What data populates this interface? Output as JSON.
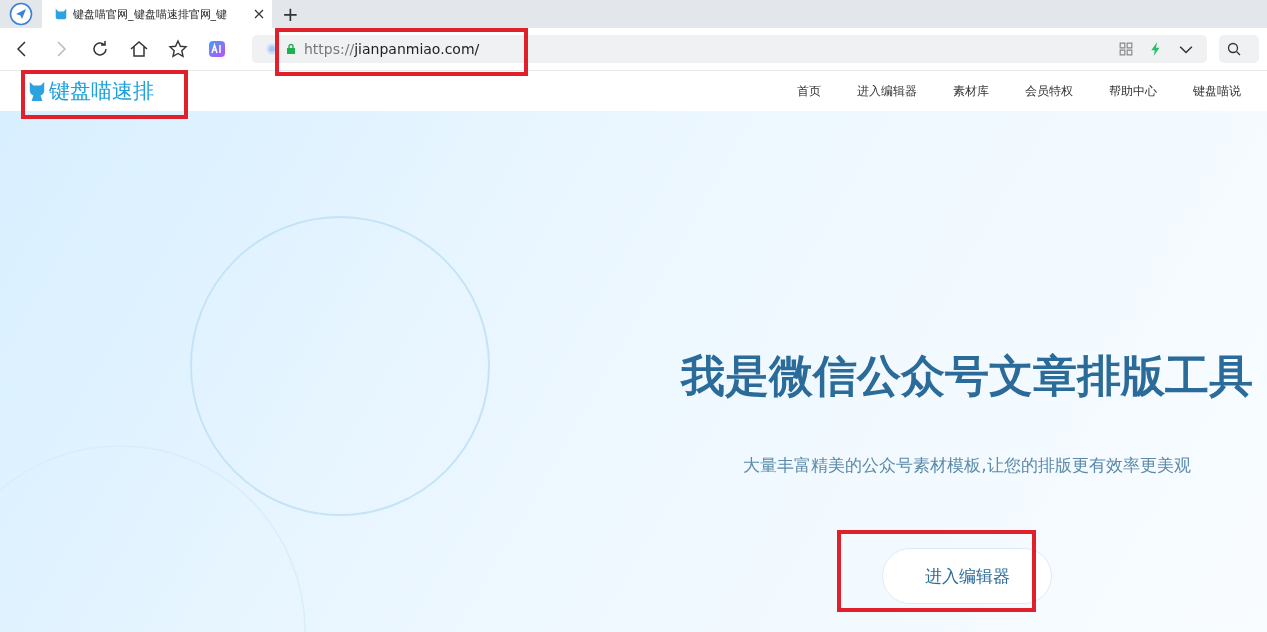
{
  "browser": {
    "tab": {
      "title": "键盘喵官网_键盘喵速排官网_键",
      "selected": true
    },
    "new_tab": "+",
    "url": {
      "scheme": "https://",
      "host": "jianpanmiao.com/"
    }
  },
  "site": {
    "logo": "键盘喵速排",
    "nav": [
      {
        "label": "首页"
      },
      {
        "label": "进入编辑器"
      },
      {
        "label": "素材库"
      },
      {
        "label": "会员特权"
      },
      {
        "label": "帮助中心"
      },
      {
        "label": "键盘喵说"
      }
    ],
    "hero": {
      "title": "我是微信公众号文章排版工具",
      "subtitle": "大量丰富精美的公众号素材模板,让您的排版更有效率更美观",
      "button": "进入编辑器"
    }
  }
}
